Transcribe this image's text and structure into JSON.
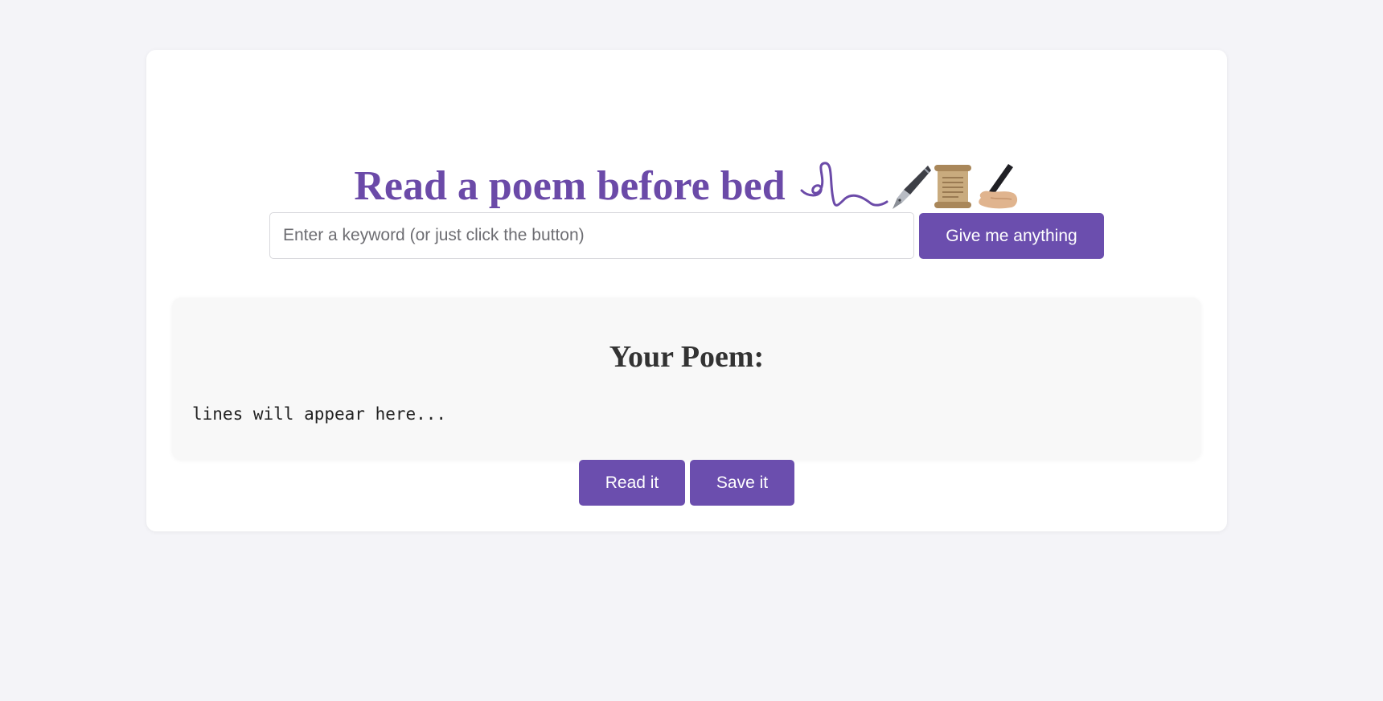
{
  "header": {
    "title": "Read a poem before bed",
    "decorations": [
      "flourish-icon",
      "fountain-pen-icon",
      "scroll-icon",
      "writing-hand-icon"
    ]
  },
  "search": {
    "placeholder": "Enter a keyword (or just click the button)",
    "value": "",
    "button_label": "Give me anything"
  },
  "poem": {
    "heading": "Your Poem:",
    "body": "lines will appear here..."
  },
  "actions": {
    "read_label": "Read it",
    "save_label": "Save it"
  },
  "colors": {
    "accent": "#6b4eae",
    "title": "#6b4aa8",
    "background": "#f4f4f8"
  }
}
